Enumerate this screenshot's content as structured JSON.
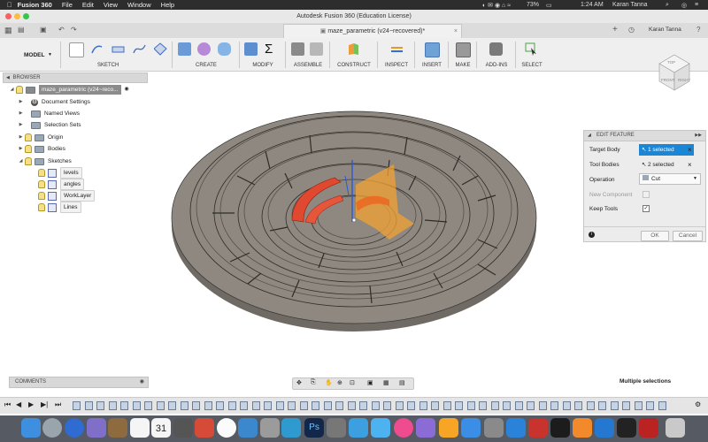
{
  "menubar": {
    "app": "Fusion 360",
    "menus": [
      "File",
      "Edit",
      "View",
      "Window",
      "Help"
    ],
    "battery": "73%",
    "time": "1:24 AM",
    "user": "Karan Tanna"
  },
  "window": {
    "title": "Autodesk Fusion 360 (Education License)"
  },
  "tab": {
    "name": "maze_parametric (v24~recovered)*",
    "user": "Karan Tanna"
  },
  "toolbar": {
    "workspace": "MODEL",
    "groups": [
      "SKETCH",
      "CREATE",
      "MODIFY",
      "ASSEMBLE",
      "CONSTRUCT",
      "INSPECT",
      "INSERT",
      "MAKE",
      "ADD-INS",
      "SELECT"
    ]
  },
  "browser": {
    "header": "BROWSER",
    "root": "maze_parametric (v24~reco...",
    "items": [
      "Document Settings",
      "Named Views",
      "Selection Sets",
      "Origin",
      "Bodies",
      "Sketches"
    ],
    "sketches": [
      "levels",
      "angles",
      "WorkLayer",
      "Lines"
    ]
  },
  "viewcube": {
    "labels": [
      "FRONT",
      "RIGHT",
      "TOP"
    ]
  },
  "edit_feature": {
    "title": "EDIT FEATURE",
    "target_label": "Target Body",
    "target_value": "1 selected",
    "tool_label": "Tool Bodies",
    "tool_value": "2 selected",
    "operation_label": "Operation",
    "operation_value": "Cut",
    "new_component_label": "New Component",
    "keep_tools_label": "Keep Tools",
    "ok": "OK",
    "cancel": "Cancel"
  },
  "comments": {
    "label": "COMMENTS"
  },
  "status": {
    "text": "Multiple selections"
  },
  "dock": {
    "calendar_day": "31"
  },
  "colors": {
    "accent": "#1b86d6",
    "cut_red": "#e0492f",
    "tool_orange": "#f3a233",
    "body": "#8e8880"
  }
}
